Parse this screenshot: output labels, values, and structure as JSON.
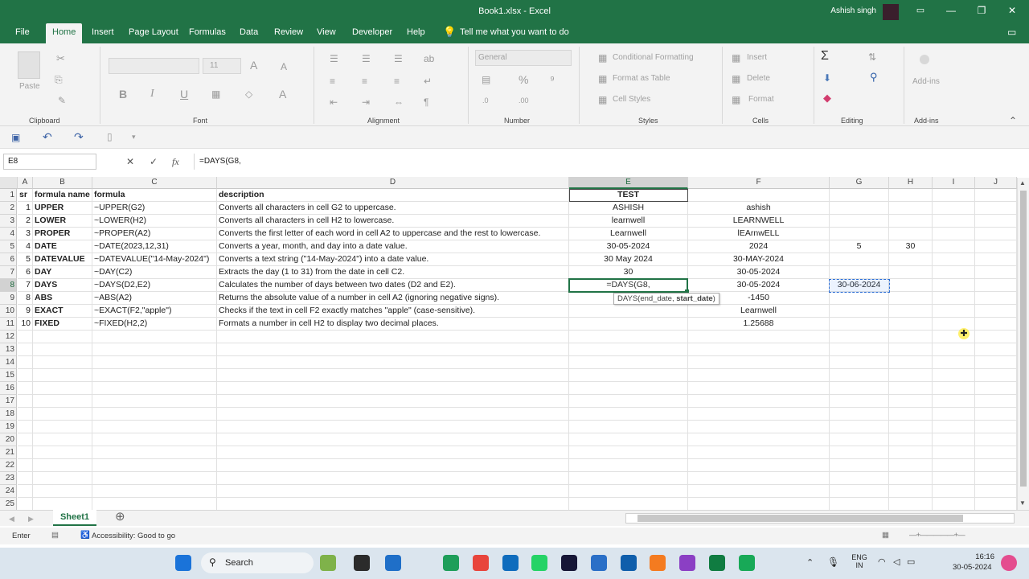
{
  "window": {
    "title": "Book1.xlsx  -  Excel",
    "user": "Ashish singh"
  },
  "menu": [
    "File",
    "Home",
    "Insert",
    "Page Layout",
    "Formulas",
    "Data",
    "Review",
    "View",
    "Developer",
    "Help"
  ],
  "tell_me": "Tell me what you want to do",
  "ribbon": {
    "clipboard": "Clipboard",
    "font": "Font",
    "alignment": "Alignment",
    "number": "Number",
    "styles": "Styles",
    "cells": "Cells",
    "editing": "Editing",
    "addins": "Add-ins",
    "paste": "Paste",
    "font_size": "11",
    "number_format": "General",
    "conditional": "Conditional Formatting",
    "format_table": "Format as Table",
    "cell_styles": "Cell Styles",
    "insert": "Insert",
    "delete": "Delete",
    "format": "Format",
    "addins_btn": "Add-ins"
  },
  "formula_bar": {
    "name_box": "E8",
    "fx": "fx",
    "formula": "=DAYS(G8,"
  },
  "columns": [
    "A",
    "B",
    "C",
    "D",
    "E",
    "F",
    "G",
    "H",
    "I",
    "J"
  ],
  "rows": [
    [
      "sr",
      "formula name",
      "formula",
      "description",
      "TEST",
      "",
      "",
      "",
      "",
      ""
    ],
    [
      "1",
      "UPPER",
      "~UPPER(G2)",
      "Converts all characters in cell G2 to uppercase.",
      "ASHISH",
      "ashish",
      "",
      "",
      "",
      ""
    ],
    [
      "2",
      "LOWER",
      "~LOWER(H2)",
      "Converts all characters in cell H2 to lowercase.",
      "learnwell",
      "LEARNWELL",
      "",
      "",
      "",
      ""
    ],
    [
      "3",
      "PROPER",
      "~PROPER(A2)",
      "Converts the first letter of each word in cell A2 to uppercase and the rest to lowercase.",
      "Learnwell",
      "lEArnwELL",
      "",
      "",
      "",
      ""
    ],
    [
      "4",
      "DATE",
      "~DATE(2023,12,31)",
      "Converts a year, month, and day into a date value.",
      "30-05-2024",
      "2024",
      "5",
      "30",
      "",
      ""
    ],
    [
      "5",
      "DATEVALUE",
      "~DATEVALUE(\"14-May-2024\")",
      "Converts a text string (\"14-May-2024\") into a date value.",
      "30 May 2024",
      "30-MAY-2024",
      "",
      "",
      "",
      ""
    ],
    [
      "6",
      "DAY",
      "~DAY(C2)",
      "Extracts the day (1 to 31) from the date in cell C2.",
      "30",
      "30-05-2024",
      "",
      "",
      "",
      ""
    ],
    [
      "7",
      "DAYS",
      "~DAYS(D2,E2)",
      "Calculates the number of days between two dates (D2 and E2).",
      "=DAYS(G8,",
      "30-05-2024",
      "30-06-2024",
      "",
      "",
      ""
    ],
    [
      "8",
      "ABS",
      "~ABS(A2)",
      "Returns the absolute value of a number in cell A2 (ignoring negative signs).",
      "",
      "-1450",
      "",
      "",
      "",
      ""
    ],
    [
      "9",
      "EXACT",
      "~EXACT(F2,\"apple\")",
      "Checks if the text in cell F2 exactly matches \"apple\" (case-sensitive).",
      "",
      "Learnwell",
      "",
      "",
      "",
      ""
    ],
    [
      "10",
      "FIXED",
      "~FIXED(H2,2)",
      "Formats a number in cell H2 to display two decimal places.",
      "",
      "1.25688",
      "",
      "",
      "",
      ""
    ]
  ],
  "empty_rows": [
    "12",
    "13",
    "14",
    "15",
    "16",
    "17",
    "18",
    "19",
    "20",
    "21",
    "22",
    "23",
    "24",
    "25"
  ],
  "tooltip": {
    "prefix": "DAYS(end_date, ",
    "bold": "start_date",
    "suffix": ")"
  },
  "sheet_tab": "Sheet1",
  "status": {
    "mode": "Enter",
    "accessibility": "Accessibility: Good to go"
  },
  "taskbar": {
    "search": "Search",
    "lang1": "ENG",
    "lang2": "IN",
    "time": "16:16",
    "date": "30-05-2024"
  },
  "colors": {
    "excel_green": "#217346",
    "ribbon_bg": "#f3f3f3",
    "taskbar_bg": "#dbe5ee"
  }
}
